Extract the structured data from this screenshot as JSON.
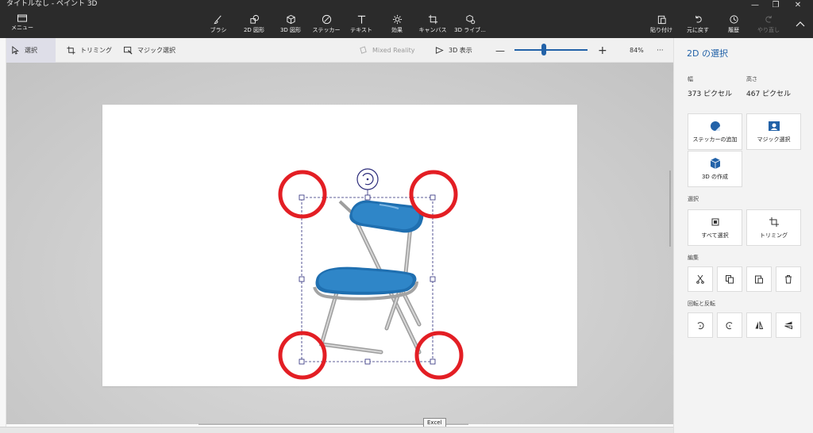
{
  "window": {
    "title": "タイトルなし - ペイント 3D",
    "menu_label": "メニュー"
  },
  "ribbon": {
    "tools": [
      {
        "label": "ブラシ",
        "icon": "brush-icon"
      },
      {
        "label": "2D 図形",
        "icon": "2d-shapes-icon"
      },
      {
        "label": "3D 図形",
        "icon": "3d-shapes-icon"
      },
      {
        "label": "ステッカー",
        "icon": "stickers-icon"
      },
      {
        "label": "テキスト",
        "icon": "text-icon"
      },
      {
        "label": "効果",
        "icon": "effects-icon"
      },
      {
        "label": "キャンバス",
        "icon": "canvas-icon"
      },
      {
        "label": "3D ライブ...",
        "icon": "3d-library-icon"
      }
    ],
    "paste_label": "貼り付け",
    "undo_label": "元に戻す",
    "history_label": "履歴",
    "redo_label": "やり直し"
  },
  "toolbar": {
    "select_label": "選択",
    "crop_label": "トリミング",
    "magic_select_label": "マジック選択",
    "mixed_reality_label": "Mixed Reality",
    "view_3d_label": "3D 表示",
    "zoom_value": "84%",
    "zoom_fraction": 0.4,
    "more_label": "···"
  },
  "panel": {
    "title": "2D の選択",
    "width_label": "幅",
    "width_value": "373 ピクセル",
    "height_label": "高さ",
    "height_value": "467 ピクセル",
    "sticker_add_label": "ステッカーの追加",
    "magic_select_label": "マジック選択",
    "make_3d_label": "3D の作成",
    "select_section": "選択",
    "select_all_label": "すべて選択",
    "crop_label": "トリミング",
    "edit_section": "編集",
    "rotate_section": "回転と反転"
  },
  "tooltip": "Excel",
  "colors": {
    "accent": "#2262a8",
    "chair_seat": "#2f86c8",
    "annotation": "#e31e24",
    "selection_handle": "#2b2b7a"
  }
}
